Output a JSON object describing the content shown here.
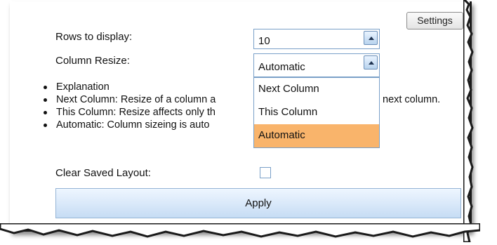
{
  "settings_button": {
    "label": "Settings"
  },
  "rows_to_display": {
    "label": "Rows to display:",
    "value": "10"
  },
  "column_resize": {
    "label": "Column Resize:",
    "value": "Automatic",
    "options": [
      "Next Column",
      "This Column",
      "Automatic"
    ],
    "selected_index": 2
  },
  "explanation": {
    "items": [
      "Explanation",
      "Next Column: Resize of a column a",
      "This Column: Resize affects only th",
      "Automatic: Column sizeing is auto"
    ],
    "overflow_tail": "next column."
  },
  "clear_saved_layout": {
    "label": "Clear Saved Layout:",
    "checked": false
  },
  "apply_button": {
    "label": "Apply"
  },
  "colors": {
    "selected_option_bg": "#f9b46b",
    "input_border": "#7aa0c8",
    "button_gradient_bottom": "#c6dcf4"
  }
}
